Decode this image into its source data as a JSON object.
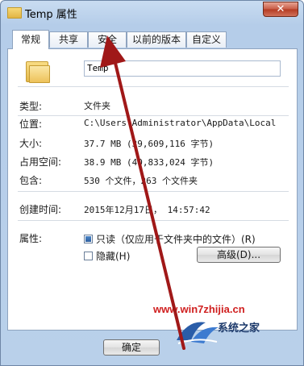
{
  "window": {
    "title": "Temp 属性",
    "close_label": "✕"
  },
  "tabs": [
    {
      "label": "常规",
      "active": true
    },
    {
      "label": "共享"
    },
    {
      "label": "安全"
    },
    {
      "label": "以前的版本"
    },
    {
      "label": "自定义"
    }
  ],
  "general": {
    "name_value": "Temp",
    "rows": {
      "type": {
        "label": "类型:",
        "value": "文件夹"
      },
      "location": {
        "label": "位置:",
        "value": "C:\\Users\\Administrator\\AppData\\Local"
      },
      "size": {
        "label": "大小:",
        "value": "37.7 MB (39,609,116 字节)"
      },
      "disk": {
        "label": "占用空间:",
        "value": "38.9 MB (40,833,024 字节)"
      },
      "contains": {
        "label": "包含:",
        "value": "530 个文件，263 个文件夹"
      },
      "created": {
        "label": "创建时间:",
        "value": "2015年12月17日， 14:57:42"
      }
    },
    "attributes": {
      "label": "属性:",
      "readonly_label": "只读（仅应用于文件夹中的文件）(R)",
      "readonly_state": "indeterminate",
      "hidden_label": "隐藏(H)",
      "hidden_checked": false,
      "advanced_label": "高级(D)..."
    }
  },
  "buttons": {
    "ok_label": "确定"
  },
  "watermark": {
    "site": "www.win7zhijia.cn",
    "logo_text": "系统之家"
  },
  "colors": {
    "arrow": "#a01818",
    "accent": "#2d5f9f"
  }
}
